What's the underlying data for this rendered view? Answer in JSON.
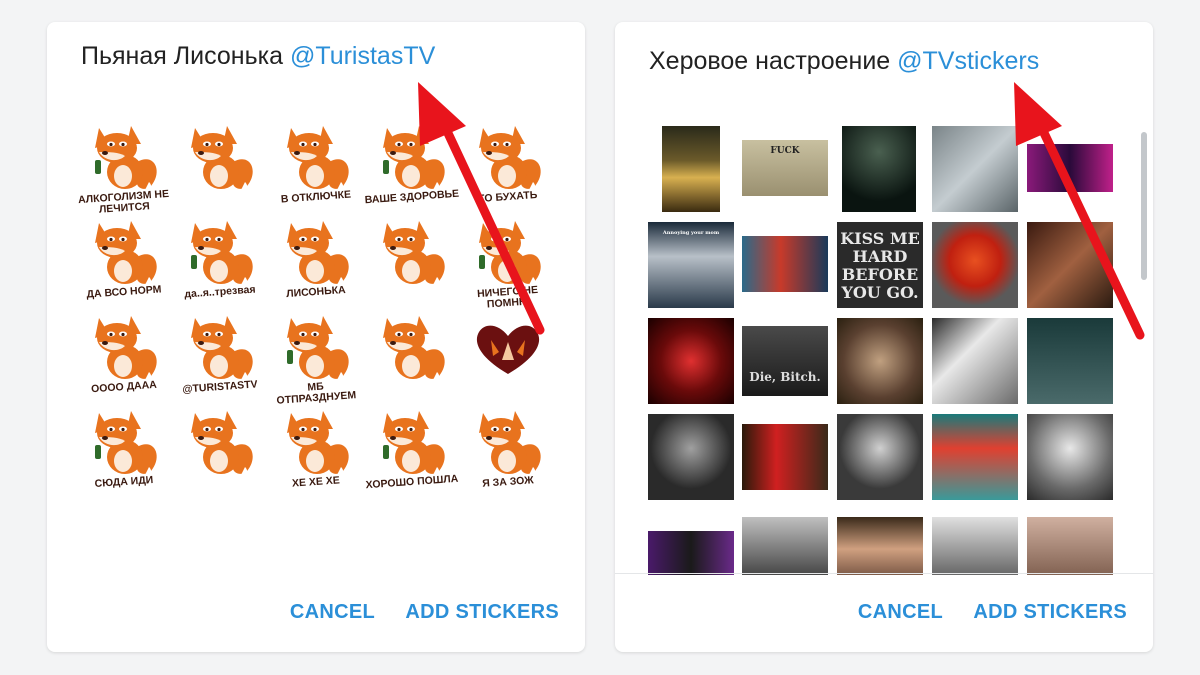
{
  "left_dialog": {
    "title": "Пьяная Лисонька",
    "title_link": "@TuristasTV",
    "cancel_label": "CANCEL",
    "add_label": "ADD STICKERS",
    "stickers": [
      {
        "caption": "АЛКОГОЛИЗМ НЕ ЛЕЧИТСЯ"
      },
      {
        "caption": ""
      },
      {
        "caption": "В ОТКЛЮЧКЕ"
      },
      {
        "caption": "ВАШЕ ЗДОРОВЬЕ"
      },
      {
        "caption": "ГО БУХАТЬ"
      },
      {
        "caption": "ДА ВСО НОРМ"
      },
      {
        "caption": "да..я..трезвая"
      },
      {
        "caption": "ЛИСОНЬКА"
      },
      {
        "caption": ""
      },
      {
        "caption": "НИЧЕГО НЕ ПОМНЮ"
      },
      {
        "caption": "ОООО ДААА"
      },
      {
        "caption": "@TURISTASTV"
      },
      {
        "caption": "МБ ОТПРАЗДНУЕМ"
      },
      {
        "caption": ""
      },
      {
        "caption": ""
      },
      {
        "caption": "СЮДА ИДИ"
      },
      {
        "caption": ""
      },
      {
        "caption": "ХЕ ХЕ ХЕ"
      },
      {
        "caption": "ХОРОШО ПОШЛА"
      },
      {
        "caption": "Я ЗА ЗОЖ"
      }
    ]
  },
  "right_dialog": {
    "title": "Херовое настроение",
    "title_link": "@TVstickers",
    "cancel_label": "CANCEL",
    "add_label": "ADD STICKERS",
    "photo_texts": {
      "fuck": "FUCK",
      "kiss": "KISS ME HARD BEFORE YOU GO.",
      "die": "Die, Bitch.",
      "annoying": "Annoying your mom"
    }
  },
  "colors": {
    "accent": "#2b8fd8",
    "arrow": "#e8141c",
    "fox": "#e8731e"
  }
}
